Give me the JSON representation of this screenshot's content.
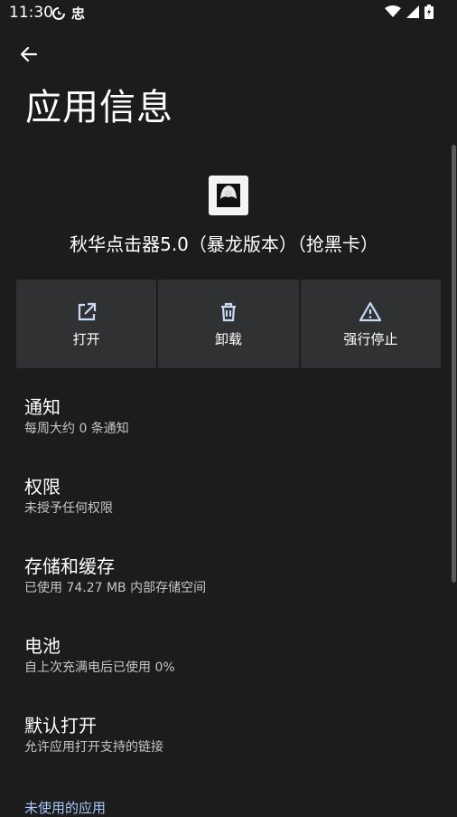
{
  "status": {
    "time": "11:30",
    "carrier_glyph": "忠"
  },
  "header": {
    "title": "应用信息"
  },
  "app": {
    "name": "秋华点击器5.0（暴龙版本）（抢黑卡）"
  },
  "actions": [
    {
      "label": "打开",
      "icon": "open-external-icon"
    },
    {
      "label": "卸载",
      "icon": "trash-icon"
    },
    {
      "label": "强行停止",
      "icon": "warning-icon"
    }
  ],
  "settings": [
    {
      "title": "通知",
      "subtitle": "每周大约 0 条通知"
    },
    {
      "title": "权限",
      "subtitle": "未授予任何权限"
    },
    {
      "title": "存储和缓存",
      "subtitle": "已使用 74.27 MB 内部存储空间"
    },
    {
      "title": "电池",
      "subtitle": "自上次充满电后已使用 0%"
    },
    {
      "title": "默认打开",
      "subtitle": "允许应用打开支持的链接"
    }
  ],
  "section": {
    "unused_apps": "未使用的应用"
  },
  "colors": {
    "background": "#1c1c1c",
    "card": "#303133",
    "accent": "#a8c7fa"
  }
}
